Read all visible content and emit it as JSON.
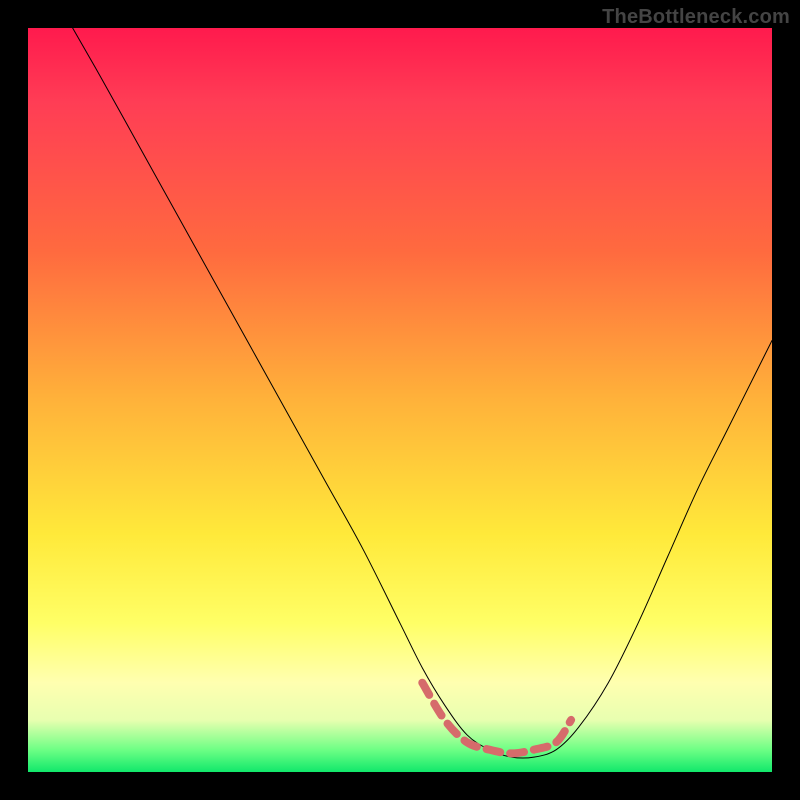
{
  "watermark": "TheBottleneck.com",
  "chart_data": {
    "type": "line",
    "title": "",
    "xlabel": "",
    "ylabel": "",
    "xlim": [
      0,
      100
    ],
    "ylim": [
      0,
      100
    ],
    "grid": false,
    "legend": false,
    "background_gradient": {
      "direction": "vertical",
      "stops": [
        {
          "pos": 0.0,
          "color": "#ff1a4d"
        },
        {
          "pos": 0.5,
          "color": "#ffb23a"
        },
        {
          "pos": 0.8,
          "color": "#ffff66"
        },
        {
          "pos": 1.0,
          "color": "#11e86b"
        }
      ]
    },
    "series": [
      {
        "name": "bottleneck-curve",
        "color": "#000000",
        "stroke_width": 1,
        "x": [
          6,
          10,
          15,
          20,
          25,
          30,
          35,
          40,
          45,
          50,
          53,
          56,
          59,
          62,
          65,
          68,
          71,
          74,
          78,
          82,
          86,
          90,
          94,
          98,
          100
        ],
        "y": [
          100,
          93,
          84,
          75,
          66,
          57,
          48,
          39,
          30,
          20,
          14,
          9,
          5,
          3,
          2,
          2,
          3,
          6,
          12,
          20,
          29,
          38,
          46,
          54,
          58
        ]
      },
      {
        "name": "highlight-valley",
        "color": "#d66b6b",
        "stroke_width": 8,
        "x": [
          53,
          56,
          59,
          62,
          65,
          68,
          71,
          73
        ],
        "y": [
          12,
          7,
          4,
          3,
          2.5,
          3,
          4,
          7
        ]
      }
    ],
    "annotations": []
  }
}
